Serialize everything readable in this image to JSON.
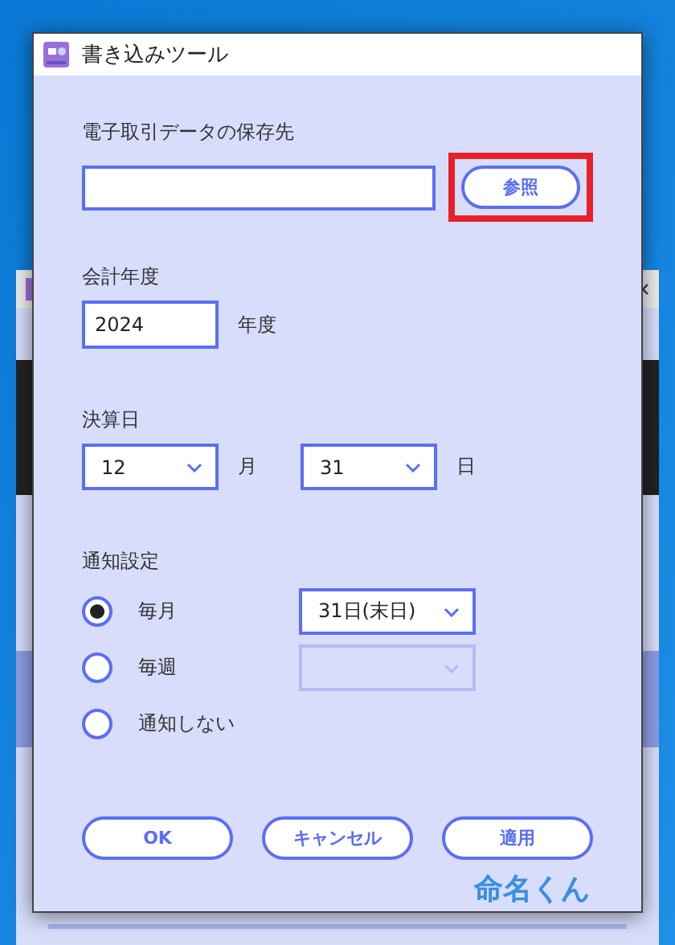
{
  "window": {
    "title": "書き込みツール"
  },
  "save_location": {
    "label": "電子取引データの保存先",
    "browse_button": {
      "label": "参照",
      "highlighted": true
    }
  },
  "fiscal_year": {
    "label": "会計年度",
    "value": "2024",
    "unit": "年度"
  },
  "closing_date": {
    "label": "決算日",
    "month": {
      "value": "12",
      "unit": "月"
    },
    "day": {
      "value": "31",
      "unit": "日"
    }
  },
  "notification": {
    "label": "通知設定",
    "options": [
      {
        "label": "毎月",
        "selected": true,
        "select": {
          "value": "31日(末日)",
          "disabled": false
        }
      },
      {
        "label": "毎週",
        "selected": false,
        "select": {
          "disabled": true
        }
      },
      {
        "label": "通知しない",
        "selected": false
      }
    ]
  },
  "buttons": [
    "OK",
    "キャンセル",
    "適用"
  ],
  "logo": "命名くん"
}
